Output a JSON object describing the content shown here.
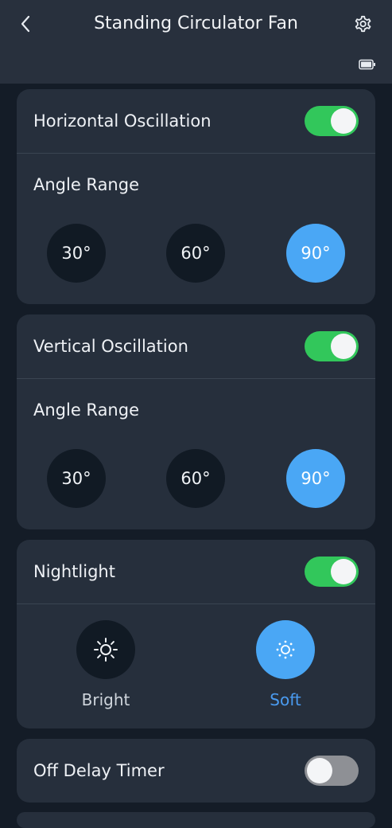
{
  "header": {
    "title": "Standing Circulator Fan",
    "back_icon": "chevron-left-icon",
    "settings_icon": "gear-icon",
    "battery_icon": "battery-icon"
  },
  "horizontal": {
    "label": "Horizontal Oscillation",
    "enabled": true,
    "angle_label": "Angle Range",
    "angles": [
      "30°",
      "60°",
      "90°"
    ],
    "selected": "90°"
  },
  "vertical": {
    "label": "Vertical Oscillation",
    "enabled": true,
    "angle_label": "Angle Range",
    "angles": [
      "30°",
      "60°",
      "90°"
    ],
    "selected": "90°"
  },
  "nightlight": {
    "label": "Nightlight",
    "enabled": true,
    "options": [
      "Bright",
      "Soft"
    ],
    "selected": "Soft"
  },
  "timer": {
    "label": "Off Delay Timer",
    "enabled": false
  },
  "colors": {
    "toggle_on": "#32c75b",
    "toggle_off": "#8e9095",
    "accent": "#4aa7f5",
    "card_bg": "#262f3c",
    "page_bg": "#141c27"
  }
}
